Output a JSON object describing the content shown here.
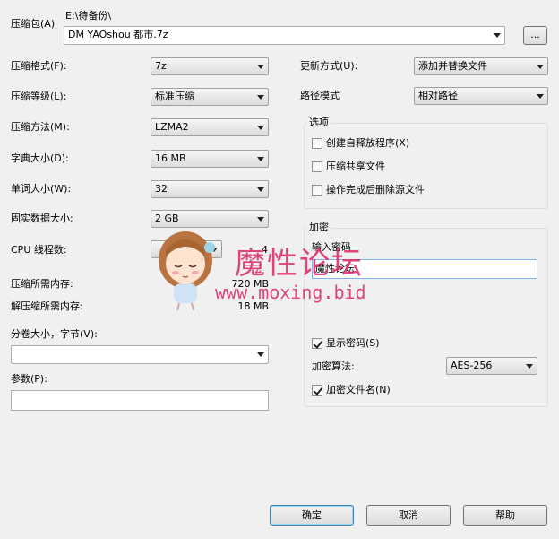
{
  "archive": {
    "label": "压缩包(A)",
    "path_dir": "E:\\待备份\\",
    "filename": "DM YAOshou 都市.7z",
    "browse_label": "..."
  },
  "left": {
    "format": {
      "label": "压缩格式(F):",
      "value": "7z"
    },
    "level": {
      "label": "压缩等级(L):",
      "value": "标准压缩"
    },
    "method": {
      "label": "压缩方法(M):",
      "value": "LZMA2"
    },
    "dict": {
      "label": "字典大小(D):",
      "value": "16 MB"
    },
    "word": {
      "label": "单词大小(W):",
      "value": "32"
    },
    "solid": {
      "label": "固实数据大小:",
      "value": "2 GB"
    },
    "cpu": {
      "label": "CPU 线程数:",
      "value": "",
      "total": "4"
    },
    "mem_compress": {
      "label": "压缩所需内存:",
      "value": "720 MB"
    },
    "mem_decompress": {
      "label": "解压缩所需内存:",
      "value": "18 MB"
    },
    "volume": {
      "label": "分卷大小，字节(V):",
      "value": ""
    },
    "params": {
      "label": "参数(P):",
      "value": ""
    }
  },
  "right": {
    "update": {
      "label": "更新方式(U):",
      "value": "添加并替换文件"
    },
    "pathmode": {
      "label": "路径模式",
      "value": "相对路径"
    },
    "options": {
      "title": "选项",
      "items": [
        {
          "label": "创建自释放程序(X)",
          "checked": false
        },
        {
          "label": "压缩共享文件",
          "checked": false
        },
        {
          "label": "操作完成后删除源文件",
          "checked": false
        }
      ]
    },
    "encryption": {
      "title": "加密",
      "password_label": "输入密码",
      "password_value": "魔性论坛",
      "show_password": {
        "label": "显示密码(S)",
        "checked": true
      },
      "method_label": "加密算法:",
      "method_value": "AES-256",
      "encrypt_names": {
        "label": "加密文件名(N)",
        "checked": true
      }
    }
  },
  "buttons": {
    "ok": "确定",
    "cancel": "取消",
    "help": "帮助"
  },
  "watermark": {
    "title": "魔性论坛",
    "url": "www.moxing.bid"
  },
  "colors": {
    "watermark": "#e0306a",
    "accent_border": "#3c7fb1"
  }
}
